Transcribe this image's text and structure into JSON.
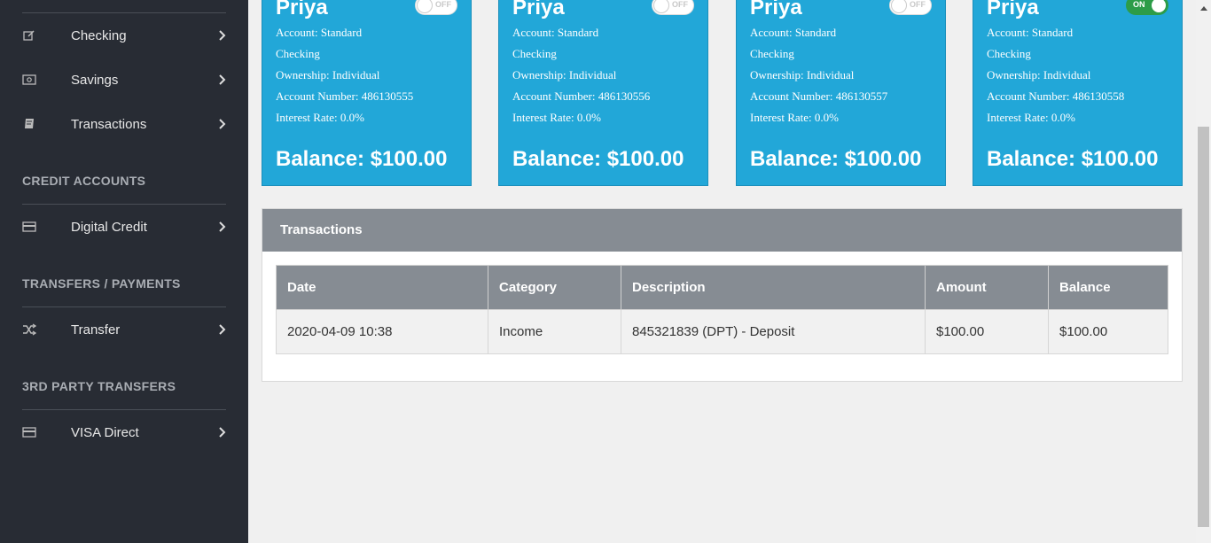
{
  "sidebar": {
    "items_top": [
      {
        "label": "Checking",
        "icon": "edit-icon"
      },
      {
        "label": "Savings",
        "icon": "money-icon"
      },
      {
        "label": "Transactions",
        "icon": "book-icon"
      }
    ],
    "section_credit": {
      "heading": "CREDIT ACCOUNTS",
      "item": "Digital Credit",
      "icon": "credit-card-icon"
    },
    "section_transfers": {
      "heading": "TRANSFERS / PAYMENTS",
      "item": "Transfer",
      "icon": "shuffle-icon"
    },
    "section_third": {
      "heading": "3RD PARTY TRANSFERS",
      "item": "VISA Direct",
      "icon": "credit-card-icon"
    }
  },
  "cards": [
    {
      "name": "Priya",
      "account": "Account: Standard",
      "type": "Checking",
      "ownership": "Ownership: Individual",
      "number": "Account Number: 486130555",
      "rate": "Interest Rate: 0.0%",
      "balance": "Balance: $100.00",
      "toggle": "OFF"
    },
    {
      "name": "Priya",
      "account": "Account: Standard",
      "type": "Checking",
      "ownership": "Ownership: Individual",
      "number": "Account Number: 486130556",
      "rate": "Interest Rate: 0.0%",
      "balance": "Balance: $100.00",
      "toggle": "OFF"
    },
    {
      "name": "Priya",
      "account": "Account: Standard",
      "type": "Checking",
      "ownership": "Ownership: Individual",
      "number": "Account Number: 486130557",
      "rate": "Interest Rate: 0.0%",
      "balance": "Balance: $100.00",
      "toggle": "OFF"
    },
    {
      "name": "Priya",
      "account": "Account: Standard",
      "type": "Checking",
      "ownership": "Ownership: Individual",
      "number": "Account Number: 486130558",
      "rate": "Interest Rate: 0.0%",
      "balance": "Balance: $100.00",
      "toggle": "ON"
    }
  ],
  "transactions": {
    "title": "Transactions",
    "columns": [
      "Date",
      "Category",
      "Description",
      "Amount",
      "Balance"
    ],
    "rows": [
      [
        "2020-04-09 10:38",
        "Income",
        "845321839 (DPT) - Deposit",
        "$100.00",
        "$100.00"
      ]
    ]
  },
  "colors": {
    "sidebar": "#282c34",
    "card": "#22a7d8",
    "toggle_on": "#2d9c48",
    "table_head": "#868c93"
  }
}
